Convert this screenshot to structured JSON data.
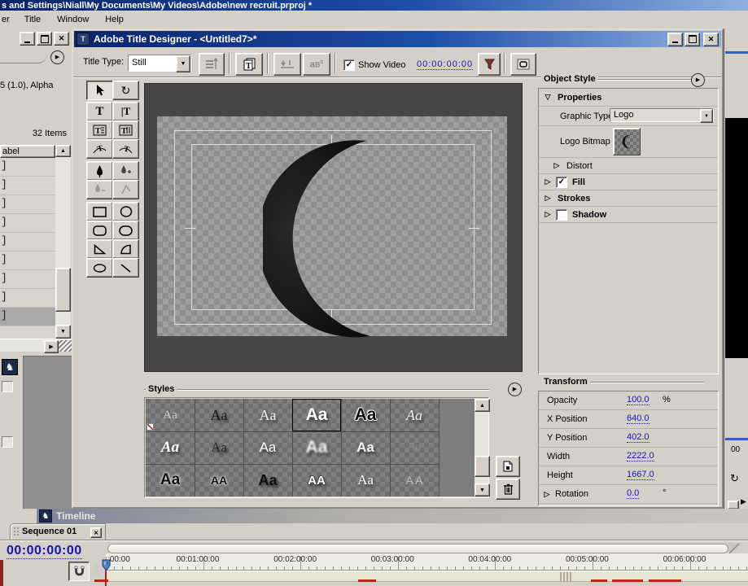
{
  "titlebar_path": "s and Settings\\Niall\\My Documents\\My Videos\\Adobe\\new recruit.prproj *",
  "menu": {
    "items": [
      "er",
      "Title",
      "Window",
      "Help"
    ]
  },
  "project_panel": {
    "preview_info": "5 (1.0), Alpha",
    "item_count": "32 Items",
    "column_header": "abel",
    "row_glyphs": [
      "]",
      "]",
      "]",
      "]",
      "]",
      "]",
      "]",
      "]",
      "]"
    ],
    "selected_row_index": 8
  },
  "title_designer": {
    "window_title": "Adobe Title Designer - <Untitled7>*",
    "toolbar": {
      "title_type_label": "Title Type:",
      "title_type_value": "Still",
      "show_video_label": "Show Video",
      "timecode": "00:00:00:00"
    },
    "tools": [
      "selection-tool",
      "rotation-tool",
      "horizontal-type-tool",
      "vertical-type-tool",
      "horizontal-area-type-tool",
      "vertical-area-type-tool",
      "path-type-tool",
      "vertical-path-type-tool",
      "pen-tool",
      "add-anchor-point-tool",
      "delete-anchor-point-tool",
      "convert-anchor-point-tool",
      "rectangle-tool",
      "ellipse-tool",
      "rounded-rectangle-tool",
      "clipped-corner-rectangle-tool",
      "wedge-tool",
      "arc-tool",
      "oval-tool",
      "line-tool"
    ],
    "object_style": {
      "title": "Object Style",
      "rows": [
        {
          "label": "Properties",
          "expander": "down",
          "bold": true
        },
        {
          "label": "Graphic Type",
          "control": "dropdown",
          "value": "Logo"
        },
        {
          "label": "Logo Bitmap",
          "control": "bitmap"
        },
        {
          "label": "Distort",
          "expander": "right",
          "indent": true
        },
        {
          "label": "Fill",
          "expander": "right",
          "bold": true,
          "checkbox": "checked"
        },
        {
          "label": "Strokes",
          "expander": "right",
          "bold": true
        },
        {
          "label": "Shadow",
          "expander": "right",
          "bold": true,
          "checkbox": "unchecked"
        }
      ]
    },
    "styles_panel": {
      "title": "Styles",
      "selected_index": 3,
      "swatches": [
        {
          "text": "Aa",
          "fg": "#cccccc",
          "serif": true,
          "size": 15,
          "marker": true
        },
        {
          "text": "Aa",
          "fg": "#16161a",
          "serif": true,
          "size": 18,
          "shadow": true
        },
        {
          "text": "Aa",
          "fg": "#f2f2f2",
          "serif": true,
          "size": 18,
          "shadow": true
        },
        {
          "text": "Aa",
          "fg": "#ffffff",
          "bold": true,
          "size": 21,
          "shadow": true
        },
        {
          "text": "Aa",
          "fg": "#0d0d0d",
          "bold": true,
          "size": 21,
          "outline": "#ffffff",
          "shadow": true
        },
        {
          "text": "Aa",
          "fg": "#ededed",
          "serif": true,
          "italic": true,
          "size": 18,
          "shadow": true
        },
        {
          "text": "Aa",
          "fg": "#ffffff",
          "serif": true,
          "italic": true,
          "bold": true,
          "size": 19,
          "shadow": true
        },
        {
          "text": "Aa",
          "fg": "#26262a",
          "serif": true,
          "size": 17,
          "shadow": true
        },
        {
          "text": "Aa",
          "fg": "#fafafa",
          "size": 17,
          "shadow": true
        },
        {
          "text": "Aa",
          "fg": "#ffffff",
          "bold": true,
          "size": 21,
          "blur": true,
          "shadow": true
        },
        {
          "text": "Aa",
          "fg": "#f5f5f5",
          "bold": true,
          "size": 17,
          "shadow": true
        },
        {
          "text": "Aa",
          "fg": "#9a9a9a",
          "serif": true,
          "italic": true,
          "size": 16,
          "ghost": true
        },
        {
          "text": "Aa",
          "fg": "#101010",
          "bold": true,
          "size": 19,
          "halo": true
        },
        {
          "text": "AA",
          "fg": "#141414",
          "bold": true,
          "size": 14,
          "halo": true
        },
        {
          "text": "Aa",
          "fg": "#0f0f0f",
          "bold": true,
          "size": 18,
          "shadow": true
        },
        {
          "text": "AA",
          "fg": "#ffffff",
          "bold": true,
          "size": 15,
          "outline": "#444444",
          "shadow": true
        },
        {
          "text": "Aa",
          "fg": "#fbfbfb",
          "serif": true,
          "size": 17,
          "shadow": true
        },
        {
          "text": "A A",
          "fg": "#c0c0c0",
          "size": 14
        }
      ]
    },
    "transform": {
      "title": "Transform",
      "rows": [
        {
          "label": "Opacity",
          "value": "100.0",
          "suffix": "%"
        },
        {
          "label": "X Position",
          "value": "640.0",
          "suffix": ""
        },
        {
          "label": "Y Position",
          "value": "402.0",
          "suffix": ""
        },
        {
          "label": "Width",
          "value": "2222.0",
          "suffix": ""
        },
        {
          "label": "Height",
          "value": "1667.0",
          "suffix": ""
        },
        {
          "label": "Rotation",
          "value": "0.0",
          "suffix": "°",
          "expander": "right"
        }
      ]
    }
  },
  "timeline": {
    "window_title": "Timeline",
    "tab_label": "Sequence 01",
    "timecode": "00:00:00:00",
    "ruler_labels": [
      ":00:00",
      "00:01:00:00",
      "00:02:00:00",
      "00:03:00:00",
      "00:04:00:00",
      "00:05:00:00",
      "00:06:00:00"
    ]
  },
  "right_panel_fragment": {
    "timecode_fragment": "00"
  },
  "colors": {
    "active_titlebar": "#0a246a",
    "timecode_blue": "#1515b5",
    "canvas_bg": "#474747",
    "render_red": "#c32315",
    "window_chrome": "#d4d0c8"
  }
}
